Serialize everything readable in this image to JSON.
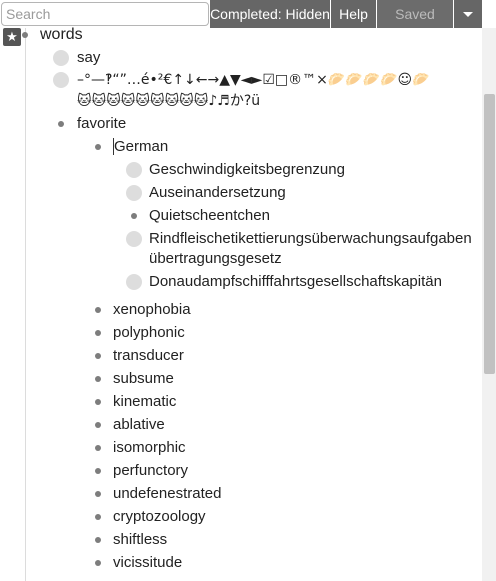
{
  "toolbar": {
    "search_placeholder": "Search",
    "completed_label": "Completed: Hidden",
    "help_label": "Help",
    "saved_label": "Saved"
  },
  "outline": {
    "root": "words",
    "say": "say",
    "symbols_line1": "–°—‽“”…é•²€↑↓←→▲▼◄►☑□®™×🥟🥟🥟🥟☺🥟",
    "symbols_line2": "🐱🐱🐱🐱🐱🐱🐱🐱🐱♪♬か?ü",
    "favorite": "favorite",
    "german": "German",
    "german_words": [
      "Geschwindigkeitsbegrenzung",
      "Auseinandersetzung",
      "Quietscheentchen",
      "Rindfleischetikettierungsüberwachungsaufgaben",
      "übertragungsgesetz",
      "Donaudampfschifffahrtsgesellschaftskapitän"
    ],
    "favorite_words": [
      "xenophobia",
      "polyphonic",
      "transducer",
      "subsume",
      "kinematic",
      "ablative",
      "isomorphic",
      "perfunctory",
      "undefenestrated",
      "cryptozoology",
      "shiftless",
      "vicissitude"
    ]
  }
}
